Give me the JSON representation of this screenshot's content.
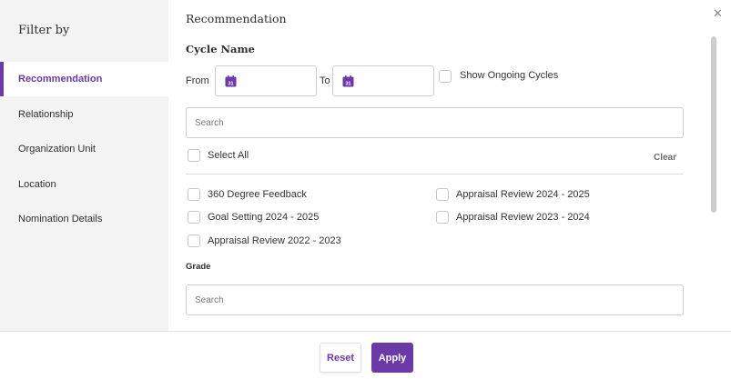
{
  "colors": {
    "accent": "#6b3aa8",
    "sidebar_bg": "#f3f3f3"
  },
  "close_icon": "close-icon",
  "sidebar": {
    "title": "Filter by",
    "items": [
      {
        "label": "Recommendation",
        "active": true
      },
      {
        "label": "Relationship",
        "active": false
      },
      {
        "label": "Organization Unit",
        "active": false
      },
      {
        "label": "Location",
        "active": false
      },
      {
        "label": "Nomination Details",
        "active": false
      }
    ]
  },
  "main": {
    "section_title": "Recommendation",
    "cycle": {
      "title": "Cycle Name",
      "from_label": "From",
      "to_label": "To",
      "calendar_icon": "calendar-icon",
      "calendar_day": "31",
      "show_ongoing_label": "Show Ongoing Cycles",
      "search_placeholder": "Search",
      "select_all_label": "Select All",
      "clear_label": "Clear",
      "options": [
        {
          "label": "360 Degree Feedback",
          "checked": false
        },
        {
          "label": "Appraisal Review 2024 - 2025",
          "checked": false
        },
        {
          "label": "Goal Setting 2024 - 2025",
          "checked": false
        },
        {
          "label": "Appraisal Review 2023 - 2024",
          "checked": false
        },
        {
          "label": "Appraisal Review 2022 - 2023",
          "checked": false
        }
      ]
    },
    "grade": {
      "title": "Grade",
      "search_placeholder": "Search"
    }
  },
  "footer": {
    "reset_label": "Reset",
    "apply_label": "Apply"
  }
}
